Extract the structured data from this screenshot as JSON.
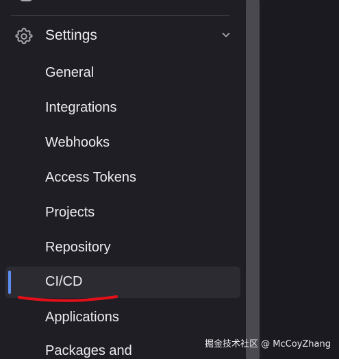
{
  "colors": {
    "background": "#1b1a21",
    "sidebar_bg": "#1f1e24",
    "text": "#ececef",
    "icon": "#a9a8b1",
    "active_bg": "#2c2b31",
    "active_indicator": "#5b8ef0",
    "annotation_red": "#e3101a",
    "scrollbar_thumb": "#4a4950"
  },
  "sidebar": {
    "section": {
      "label": "Settings",
      "icon": "gear-icon",
      "expanded": true,
      "chevron_icon": "chevron-down-icon"
    },
    "items": [
      {
        "label": "General",
        "active": false
      },
      {
        "label": "Integrations",
        "active": false
      },
      {
        "label": "Webhooks",
        "active": false
      },
      {
        "label": "Access Tokens",
        "active": false
      },
      {
        "label": "Projects",
        "active": false
      },
      {
        "label": "Repository",
        "active": false
      },
      {
        "label": "CI/CD",
        "active": true
      },
      {
        "label": "Applications",
        "active": false
      },
      {
        "label": "Packages and",
        "active": false
      }
    ]
  },
  "watermark": "掘金技术社区 @ McCoyZhang"
}
